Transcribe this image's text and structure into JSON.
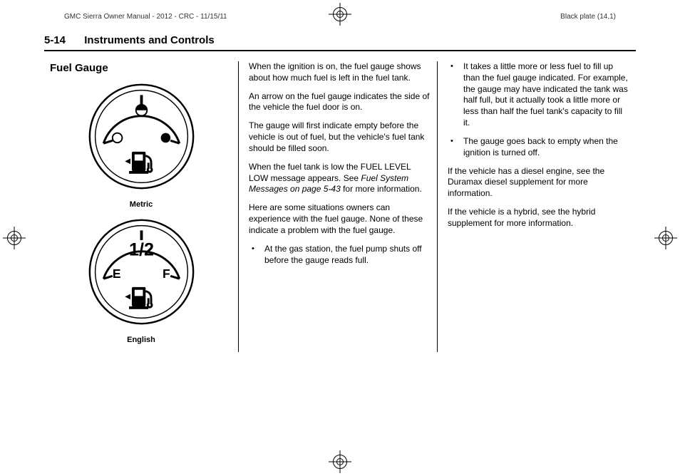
{
  "header": {
    "left": "GMC Sierra Owner Manual - 2012 - CRC - 11/15/11",
    "right": "Black plate (14,1)"
  },
  "page": {
    "number": "5-14",
    "chapter": "Instruments and Controls"
  },
  "col1": {
    "title": "Fuel Gauge",
    "caption_metric": "Metric",
    "caption_english": "English",
    "english_label": "1/2",
    "english_e": "E",
    "english_f": "F"
  },
  "col2": {
    "p1": "When the ignition is on, the fuel gauge shows about how much fuel is left in the fuel tank.",
    "p2": "An arrow on the fuel gauge indicates the side of the vehicle the fuel door is on.",
    "p3": "The gauge will first indicate empty before the vehicle is out of fuel, but the vehicle's fuel tank should be filled soon.",
    "p4a": "When the fuel tank is low the FUEL LEVEL LOW message appears. See ",
    "p4b": "Fuel System Messages on page 5-43",
    "p4c": " for more information.",
    "p5": "Here are some situations owners can experience with the fuel gauge. None of these indicate a problem with the fuel gauge.",
    "b1": "At the gas station, the fuel pump shuts off before the gauge reads full."
  },
  "col3": {
    "b2": "It takes a little more or less fuel to fill up than the fuel gauge indicated. For example, the gauge may have indicated the tank was half full, but it actually took a little more or less than half the fuel tank's capacity to fill it.",
    "b3": "The gauge goes back to empty when the ignition is turned off.",
    "p1": "If the vehicle has a diesel engine, see the Duramax diesel supplement for more information.",
    "p2": "If the vehicle is a hybrid, see the hybrid supplement for more information."
  }
}
